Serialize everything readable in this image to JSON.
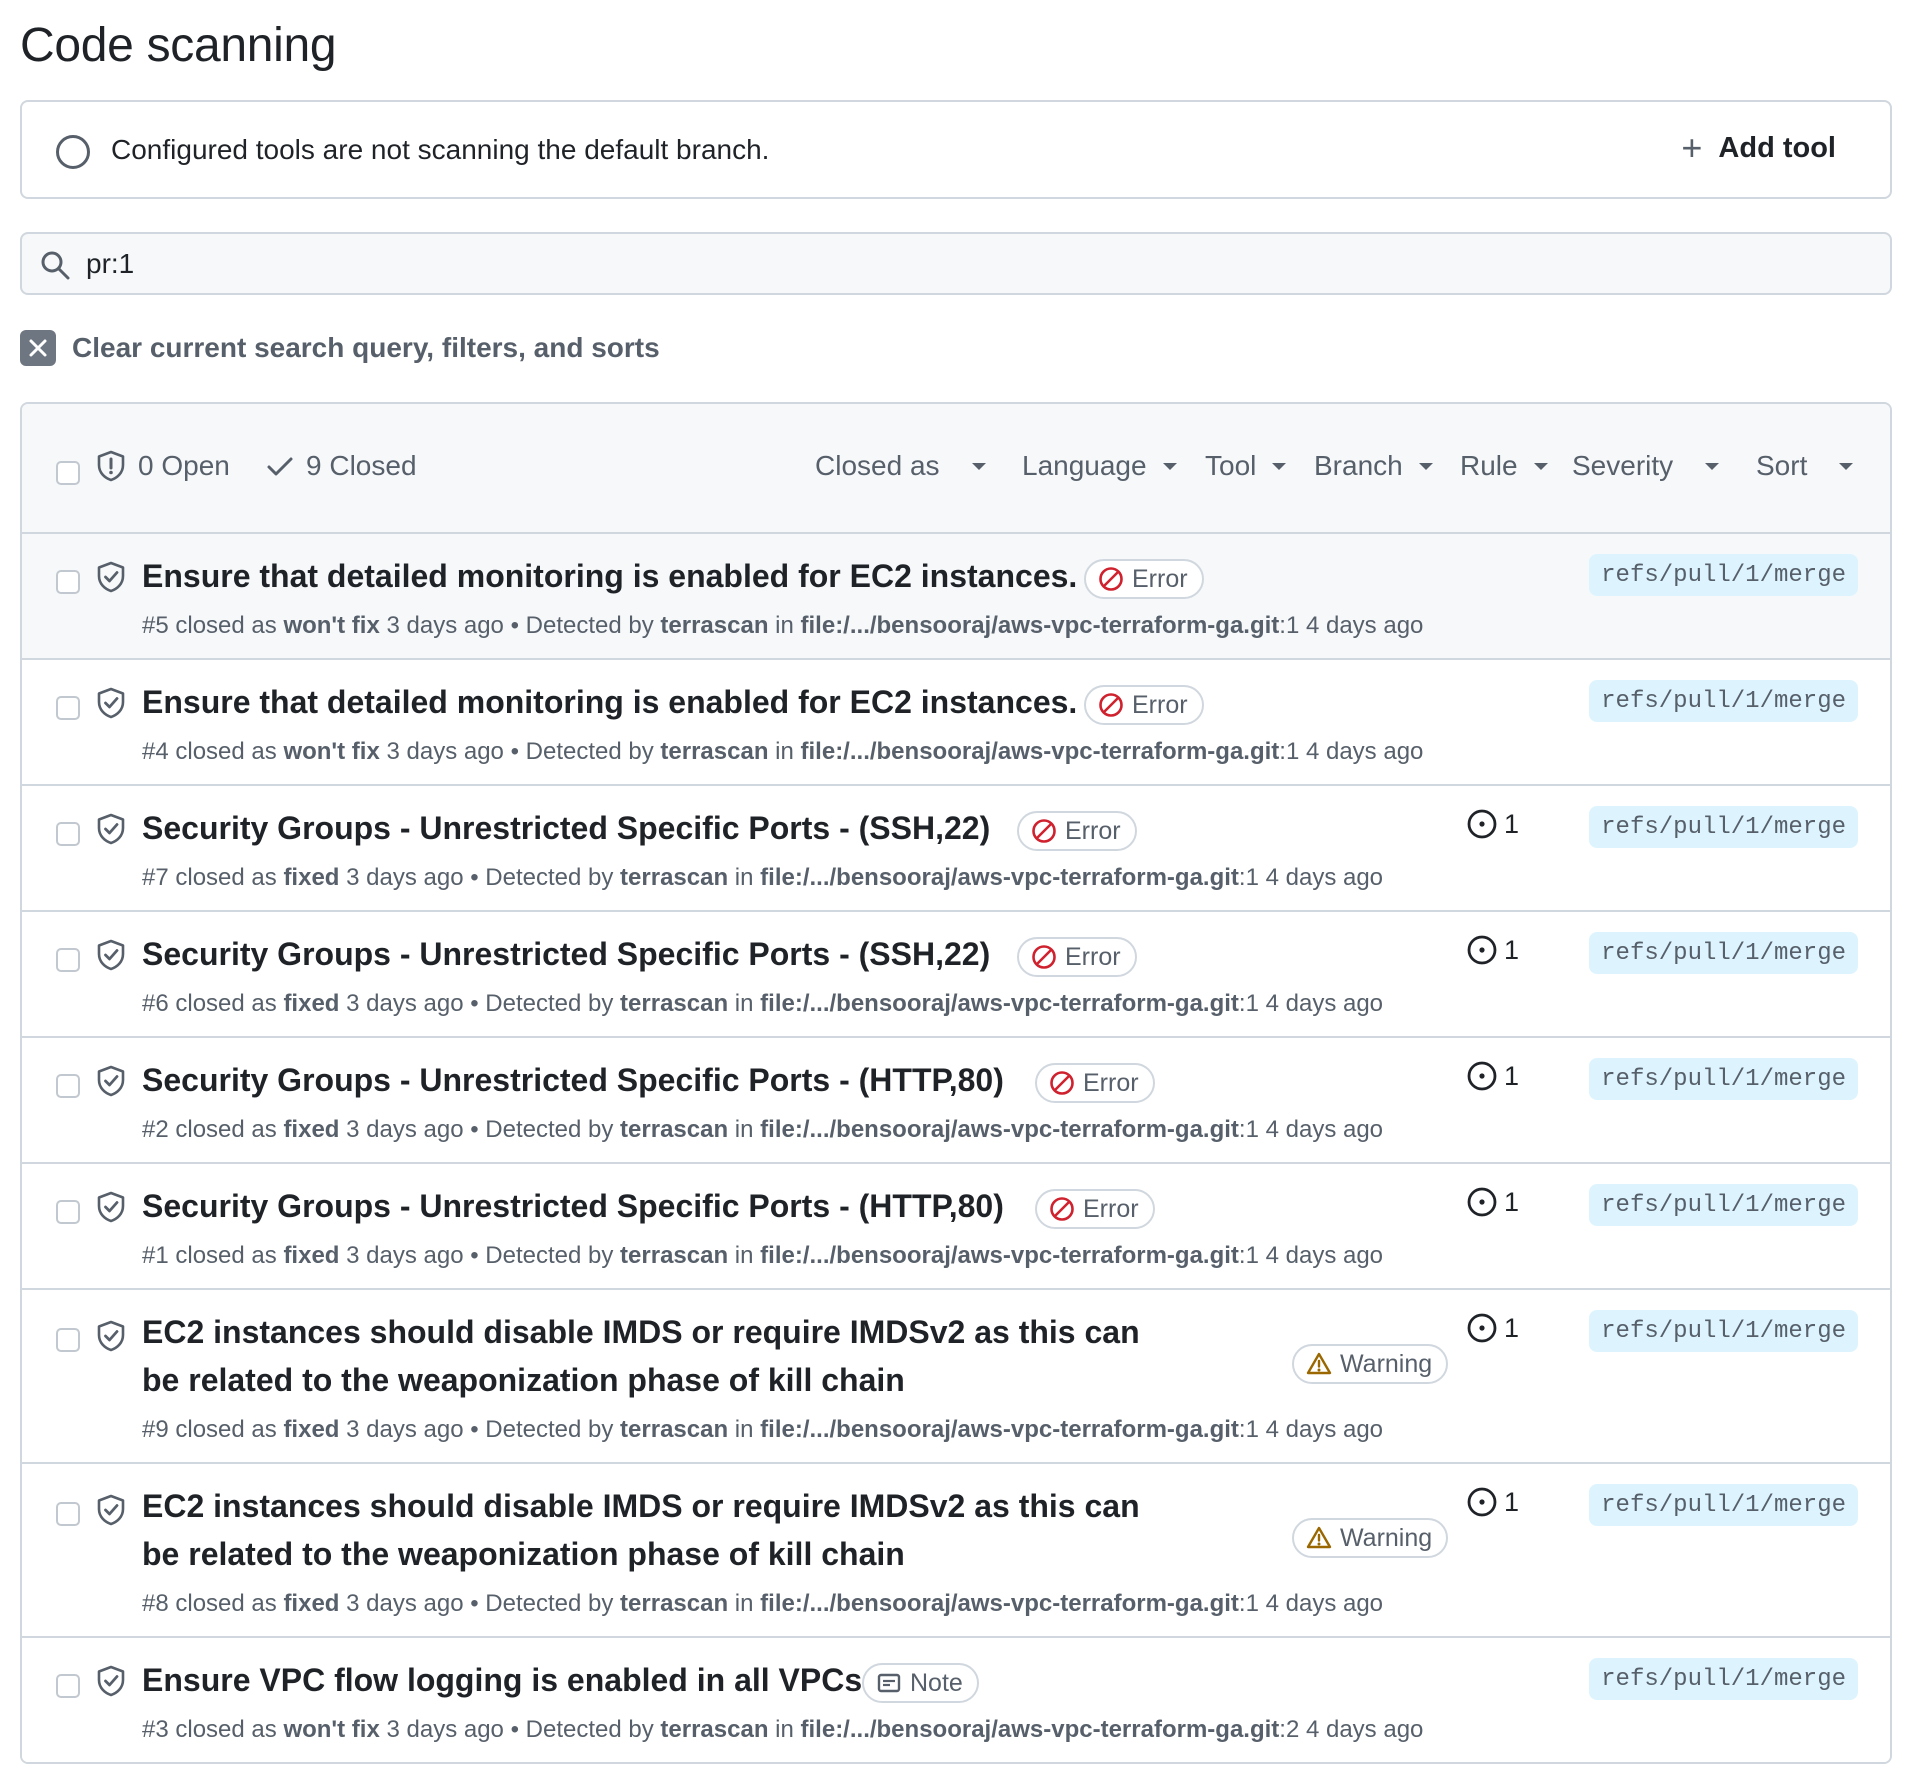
{
  "page": {
    "title": "Code scanning"
  },
  "banner": {
    "text": "Configured tools are not scanning the default branch.",
    "add_tool_label": "Add tool"
  },
  "search": {
    "value": "pr:1"
  },
  "clear": {
    "label": "Clear current search query, filters, and sorts"
  },
  "header": {
    "open_label": "0 Open",
    "closed_label": "9 Closed",
    "filters": [
      "Closed as",
      "Language",
      "Tool",
      "Branch",
      "Rule",
      "Severity",
      "Sort"
    ]
  },
  "colors": {
    "error": "#cf222e",
    "warning": "#9a6700",
    "ref_bg": "#ddf4ff",
    "border": "#d0d7de"
  },
  "alerts": [
    {
      "title": "Ensure that detailed monitoring is enabled for EC2 instances.",
      "severity": "Error",
      "severity_icon": "stop-icon",
      "number": "#5",
      "closed_as_prefix": "closed as",
      "closed_as": "won't fix",
      "closed_ago": "3 days ago",
      "detected_by_prefix": "Detected by",
      "tool": "terrascan",
      "in_prefix": "in",
      "file": "file:/.../bensooraj/aws-vpc-terraform-ga.git",
      "line": ":1",
      "detected_ago": "4 days ago",
      "issues": "",
      "ref": "refs/pull/1/merge"
    },
    {
      "title": "Ensure that detailed monitoring is enabled for EC2 instances.",
      "severity": "Error",
      "severity_icon": "stop-icon",
      "number": "#4",
      "closed_as_prefix": "closed as",
      "closed_as": "won't fix",
      "closed_ago": "3 days ago",
      "detected_by_prefix": "Detected by",
      "tool": "terrascan",
      "in_prefix": "in",
      "file": "file:/.../bensooraj/aws-vpc-terraform-ga.git",
      "line": ":1",
      "detected_ago": "4 days ago",
      "issues": "",
      "ref": "refs/pull/1/merge"
    },
    {
      "title": "Security Groups - Unrestricted Specific Ports - (SSH,22)",
      "severity": "Error",
      "severity_icon": "stop-icon",
      "number": "#7",
      "closed_as_prefix": "closed as",
      "closed_as": "fixed",
      "closed_ago": "3 days ago",
      "detected_by_prefix": "Detected by",
      "tool": "terrascan",
      "in_prefix": "in",
      "file": "file:/.../bensooraj/aws-vpc-terraform-ga.git",
      "line": ":1",
      "detected_ago": "4 days ago",
      "issues": "1",
      "ref": "refs/pull/1/merge"
    },
    {
      "title": "Security Groups - Unrestricted Specific Ports - (SSH,22)",
      "severity": "Error",
      "severity_icon": "stop-icon",
      "number": "#6",
      "closed_as_prefix": "closed as",
      "closed_as": "fixed",
      "closed_ago": "3 days ago",
      "detected_by_prefix": "Detected by",
      "tool": "terrascan",
      "in_prefix": "in",
      "file": "file:/.../bensooraj/aws-vpc-terraform-ga.git",
      "line": ":1",
      "detected_ago": "4 days ago",
      "issues": "1",
      "ref": "refs/pull/1/merge"
    },
    {
      "title": "Security Groups - Unrestricted Specific Ports - (HTTP,80)",
      "severity": "Error",
      "severity_icon": "stop-icon",
      "number": "#2",
      "closed_as_prefix": "closed as",
      "closed_as": "fixed",
      "closed_ago": "3 days ago",
      "detected_by_prefix": "Detected by",
      "tool": "terrascan",
      "in_prefix": "in",
      "file": "file:/.../bensooraj/aws-vpc-terraform-ga.git",
      "line": ":1",
      "detected_ago": "4 days ago",
      "issues": "1",
      "ref": "refs/pull/1/merge"
    },
    {
      "title": "Security Groups - Unrestricted Specific Ports - (HTTP,80)",
      "severity": "Error",
      "severity_icon": "stop-icon",
      "number": "#1",
      "closed_as_prefix": "closed as",
      "closed_as": "fixed",
      "closed_ago": "3 days ago",
      "detected_by_prefix": "Detected by",
      "tool": "terrascan",
      "in_prefix": "in",
      "file": "file:/.../bensooraj/aws-vpc-terraform-ga.git",
      "line": ":1",
      "detected_ago": "4 days ago",
      "issues": "1",
      "ref": "refs/pull/1/merge"
    },
    {
      "title": "EC2 instances should disable IMDS or require IMDSv2 as this can be related to the weaponization phase of kill chain",
      "severity": "Warning",
      "severity_icon": "alert-triangle-icon",
      "number": "#9",
      "closed_as_prefix": "closed as",
      "closed_as": "fixed",
      "closed_ago": "3 days ago",
      "detected_by_prefix": "Detected by",
      "tool": "terrascan",
      "in_prefix": "in",
      "file": "file:/.../bensooraj/aws-vpc-terraform-ga.git",
      "line": ":1",
      "detected_ago": "4 days ago",
      "issues": "1",
      "ref": "refs/pull/1/merge"
    },
    {
      "title": "EC2 instances should disable IMDS or require IMDSv2 as this can be related to the weaponization phase of kill chain",
      "severity": "Warning",
      "severity_icon": "alert-triangle-icon",
      "number": "#8",
      "closed_as_prefix": "closed as",
      "closed_as": "fixed",
      "closed_ago": "3 days ago",
      "detected_by_prefix": "Detected by",
      "tool": "terrascan",
      "in_prefix": "in",
      "file": "file:/.../bensooraj/aws-vpc-terraform-ga.git",
      "line": ":1",
      "detected_ago": "4 days ago",
      "issues": "1",
      "ref": "refs/pull/1/merge"
    },
    {
      "title": "Ensure VPC flow logging is enabled in all VPCs",
      "severity": "Note",
      "severity_icon": "note-icon",
      "number": "#3",
      "closed_as_prefix": "closed as",
      "closed_as": "won't fix",
      "closed_ago": "3 days ago",
      "detected_by_prefix": "Detected by",
      "tool": "terrascan",
      "in_prefix": "in",
      "file": "file:/.../bensooraj/aws-vpc-terraform-ga.git",
      "line": ":2",
      "detected_ago": "4 days ago",
      "issues": "",
      "ref": "refs/pull/1/merge"
    }
  ]
}
